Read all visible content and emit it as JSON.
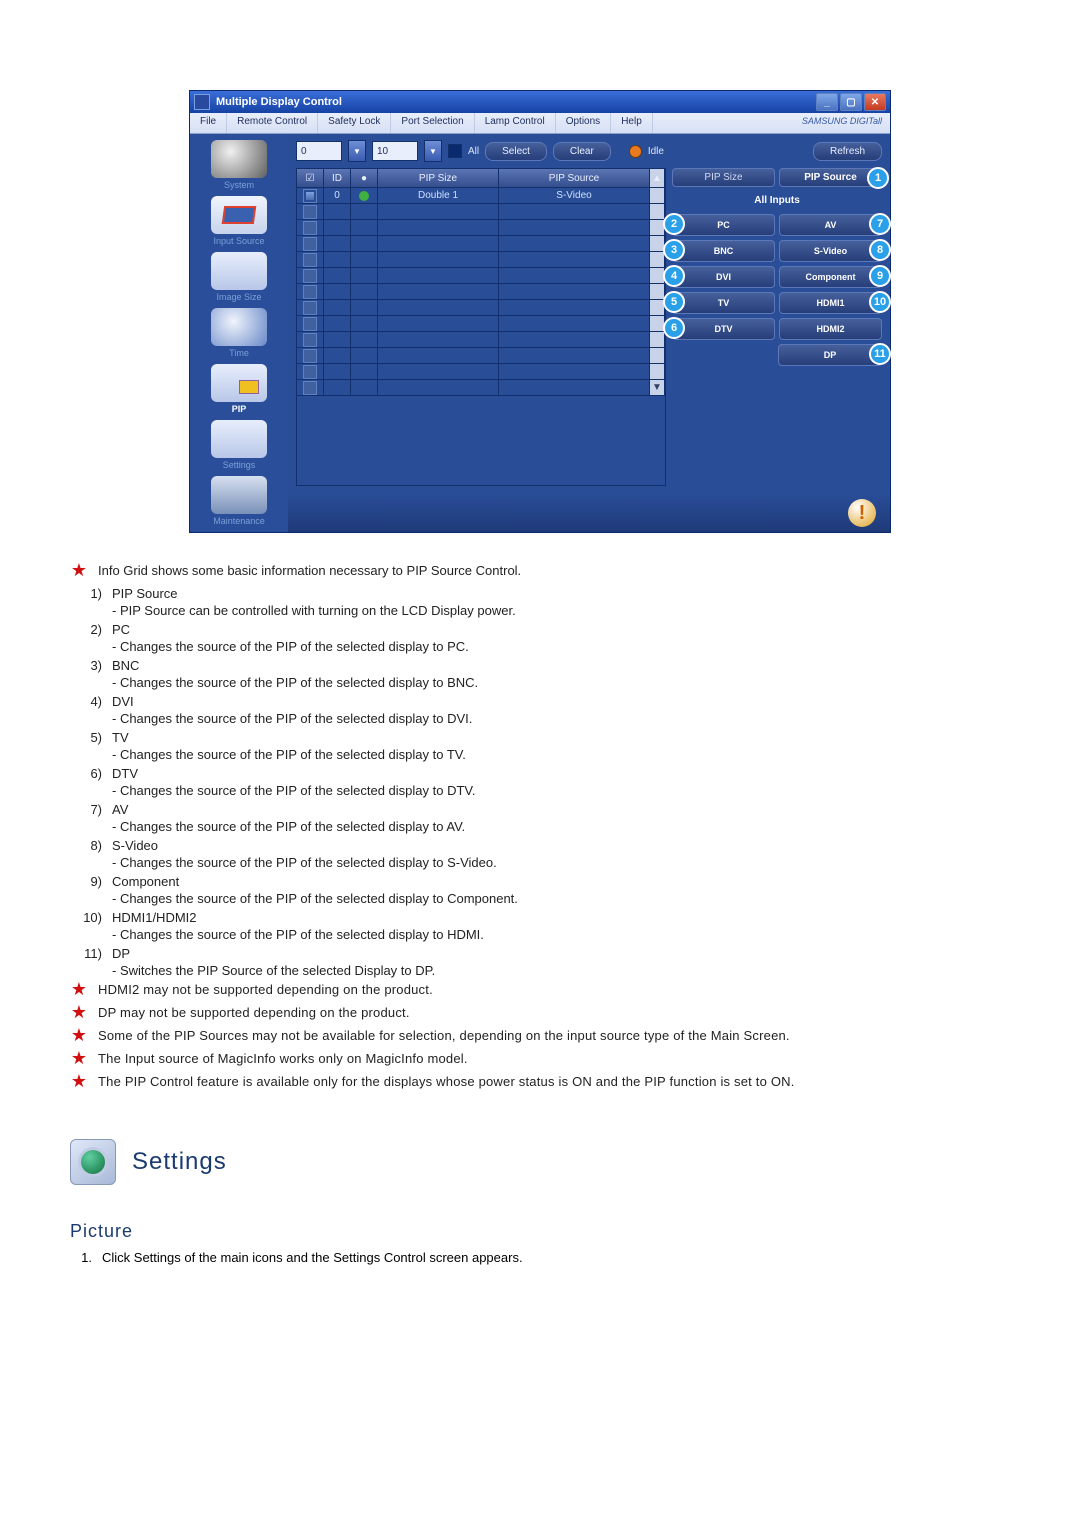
{
  "app": {
    "title": "Multiple Display Control",
    "brand": "SAMSUNG DIGITall"
  },
  "menu": {
    "file": "File",
    "remote": "Remote Control",
    "safety": "Safety Lock",
    "port": "Port Selection",
    "lamp": "Lamp Control",
    "options": "Options",
    "help": "Help"
  },
  "toolbar": {
    "val1": "0",
    "val2": "10",
    "all": "All",
    "select": "Select",
    "clear": "Clear",
    "idle": "Idle",
    "refresh": "Refresh"
  },
  "grid": {
    "head_cbx": "☑",
    "head_id": "ID",
    "head_led": "●",
    "head_size": "PIP Size",
    "head_src": "PIP Source",
    "row0_id": "0",
    "row0_size": "Double 1",
    "row0_src": "S-Video"
  },
  "panel": {
    "tab_size": "PIP Size",
    "tab_src": "PIP Source",
    "title": "All Inputs",
    "pc": "PC",
    "av": "AV",
    "bnc": "BNC",
    "svideo": "S-Video",
    "dvi": "DVI",
    "component": "Component",
    "tv": "TV",
    "hdmi1": "HDMI1",
    "dtv": "DTV",
    "hdmi2": "HDMI2",
    "dp": "DP",
    "b1": "1",
    "b2": "2",
    "b3": "3",
    "b4": "4",
    "b5": "5",
    "b6": "6",
    "b7": "7",
    "b8": "8",
    "b9": "9",
    "b10": "10",
    "b11": "11"
  },
  "sidebar": {
    "system": "System",
    "input": "Input Source",
    "image": "Image Size",
    "time": "Time",
    "pip": "PIP",
    "settings": "Settings",
    "maint": "Maintenance"
  },
  "notes": {
    "intro": "Info Grid shows some basic information necessary to PIP Source Control.",
    "items": [
      {
        "n": "1)",
        "hd": "PIP Source",
        "sub": "- PIP Source can be controlled with turning on the LCD Display power."
      },
      {
        "n": "2)",
        "hd": "PC",
        "sub": "- Changes the source of the PIP of the selected display to PC."
      },
      {
        "n": "3)",
        "hd": "BNC",
        "sub": "- Changes the source of the PIP of the selected display to BNC."
      },
      {
        "n": "4)",
        "hd": "DVI",
        "sub": "- Changes the source of the PIP of the selected display to DVI."
      },
      {
        "n": "5)",
        "hd": "TV",
        "sub": "- Changes the source of the PIP of the selected display to TV."
      },
      {
        "n": "6)",
        "hd": "DTV",
        "sub": "- Changes the source of the PIP of the selected display to DTV."
      },
      {
        "n": "7)",
        "hd": "AV",
        "sub": "- Changes the source of the PIP of the selected display to AV."
      },
      {
        "n": "8)",
        "hd": "S-Video",
        "sub": "- Changes the source of the PIP of the selected display to S-Video."
      },
      {
        "n": "9)",
        "hd": "Component",
        "sub": "- Changes the source of the PIP of the selected display to Component."
      },
      {
        "n": "10)",
        "hd": "HDMI1/HDMI2",
        "sub": "- Changes the source of the PIP of the selected display to HDMI."
      },
      {
        "n": "11)",
        "hd": "DP",
        "sub": "- Switches the PIP Source of the selected Display to DP."
      }
    ],
    "warn1": "HDMI2 may not be supported depending on the product.",
    "warn2": "DP may not be supported depending on the product.",
    "warn3": "Some of the PIP Sources may not be available for selection, depending on the input source type of the Main Screen.",
    "warn4": "The Input source of MagicInfo works only on MagicInfo model.",
    "warn5": "The PIP Control feature is available only for the displays whose power status is ON and the PIP function is set to ON."
  },
  "settings": {
    "title": "Settings",
    "sub": "Picture",
    "step1": "Click Settings of the main icons and the Settings Control screen appears."
  }
}
